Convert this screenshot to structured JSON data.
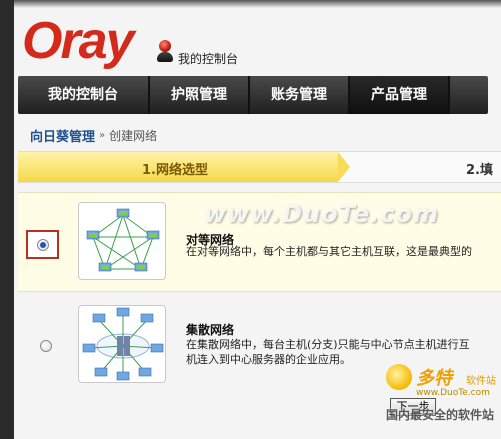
{
  "header": {
    "logo_text": "Oray",
    "console_label": "我的控制台"
  },
  "nav": {
    "items": [
      {
        "label": "我的控制台"
      },
      {
        "label": "护照管理"
      },
      {
        "label": "账务管理"
      },
      {
        "label": "产品管理",
        "active": true
      }
    ]
  },
  "breadcrumb": {
    "home": "向日葵管理",
    "separator": "»",
    "current": "创建网络"
  },
  "steps": [
    {
      "label": "1.网络选型",
      "active": true
    },
    {
      "label": "2.填"
    }
  ],
  "options": [
    {
      "title": "对等网络",
      "description": "在对等网络中，每个主机都与其它主机互联，这是最典型的",
      "selected": true
    },
    {
      "title": "集散网络",
      "description_line1": "在集散网络中，每台主机(分支)只能与中心节点主机进行互",
      "description_line2": "机连入到中心服务器的企业应用。",
      "selected": false
    }
  ],
  "watermark": "www.DuoTe.com",
  "corner_logo": {
    "brand": "多特",
    "brand_sub": "软件站",
    "url": "www.DuoTe.com"
  },
  "next_button": "下一步",
  "footer_text": "国内最安全的软件站",
  "colors": {
    "brand_red": "#d42a1b",
    "nav_bg": "#2b2b2b",
    "step_active": "#f5d94a",
    "selected_row": "#fffde6",
    "link_blue": "#1f4f8c"
  }
}
